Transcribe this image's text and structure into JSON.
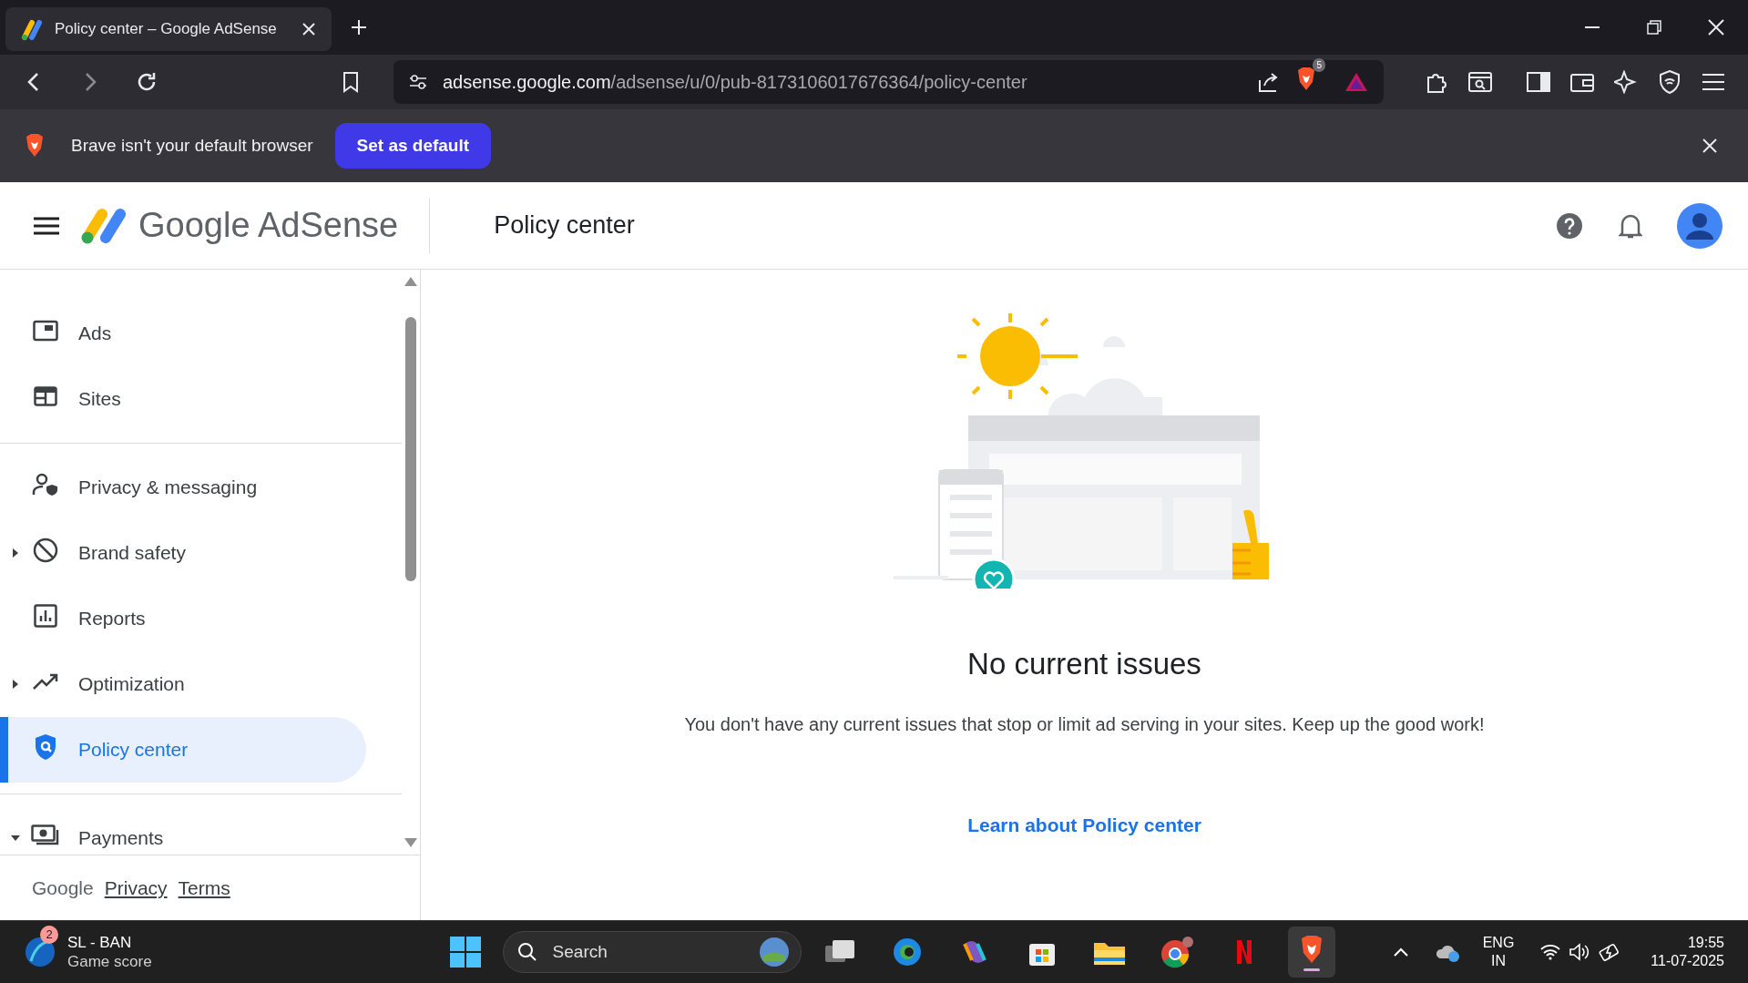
{
  "browser": {
    "tab": {
      "title": "Policy center – Google AdSense",
      "selected": true
    },
    "url": {
      "host": "adsense.google.com",
      "path": "/adsense/u/0/pub-8173106017676364/policy-center"
    },
    "shield_count": "5"
  },
  "infobar": {
    "message": "Brave isn't your default browser",
    "button": "Set as default"
  },
  "header": {
    "logo_google": "Google",
    "logo_product": "AdSense",
    "page_title": "Policy center"
  },
  "sidebar": {
    "sections": [
      {
        "items": [
          {
            "label": "Ads",
            "selected": false
          },
          {
            "label": "Sites",
            "selected": false
          }
        ]
      },
      {
        "items": [
          {
            "label": "Privacy & messaging",
            "selected": false
          },
          {
            "label": "Brand safety",
            "selected": false,
            "expanded": false
          },
          {
            "label": "Reports",
            "selected": false
          },
          {
            "label": "Optimization",
            "selected": false,
            "expanded": false
          },
          {
            "label": "Policy center",
            "selected": true
          }
        ]
      },
      {
        "items": [
          {
            "label": "Payments",
            "selected": false,
            "expanded": true
          }
        ]
      }
    ],
    "footer": {
      "brand": "Google",
      "links": [
        "Privacy",
        "Terms"
      ]
    }
  },
  "content": {
    "heading": "No current issues",
    "message": "You don't have any current issues that stop or limit ad serving in your sites. Keep up the good work!",
    "link": "Learn about Policy center"
  },
  "taskbar": {
    "widget": {
      "title": "SL - BAN",
      "subtitle": "Game score",
      "badge": "2"
    },
    "search_placeholder": "Search",
    "apps": [
      {
        "active": false
      },
      {
        "active": false
      },
      {
        "active": false
      },
      {
        "active": false
      },
      {
        "active": false
      },
      {
        "active": false
      },
      {
        "active": false
      },
      {
        "active": true
      }
    ],
    "language": [
      "ENG",
      "IN"
    ],
    "time": "19:55",
    "date": "11-07-2025"
  }
}
